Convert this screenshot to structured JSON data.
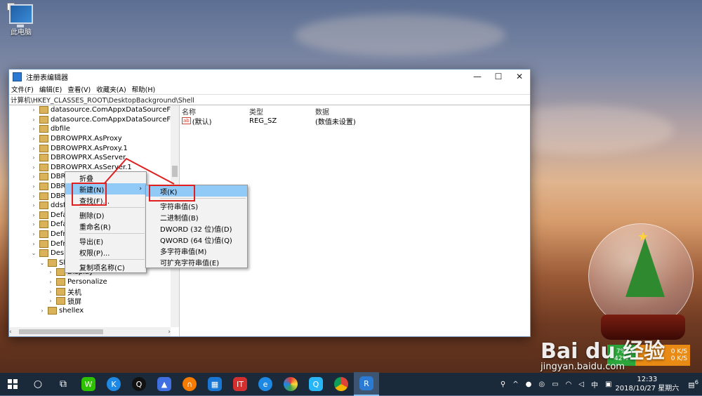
{
  "desktop": {
    "icon_label": "此电脑",
    "checkbox": "✓"
  },
  "window": {
    "title": "注册表编辑器",
    "menu": [
      "文件(F)",
      "编辑(E)",
      "查看(V)",
      "收藏夹(A)",
      "帮助(H)"
    ],
    "address": "计算机\\HKEY_CLASSES_ROOT\\DesktopBackground\\Shell",
    "controls": {
      "minimize": "—",
      "maximize": "☐",
      "close": "✕"
    }
  },
  "tree": [
    {
      "label": "datasource.ComAppxDataSourceFacto",
      "exp": "›"
    },
    {
      "label": "datasource.ComAppxDataSourceFacto",
      "exp": "›"
    },
    {
      "label": "dbfile",
      "exp": "›"
    },
    {
      "label": "DBROWPRX.AsProxy",
      "exp": "›"
    },
    {
      "label": "DBROWPRX.AsProxy.1",
      "exp": "›"
    },
    {
      "label": "DBROWPRX.AsServer",
      "exp": "›"
    },
    {
      "label": "DBROWPRX.AsServer.1",
      "exp": "›"
    },
    {
      "label": "DBRS",
      "exp": "›"
    },
    {
      "label": "DBRS",
      "exp": "›"
    },
    {
      "label": "DBRS",
      "exp": "›"
    },
    {
      "label": "ddsfi",
      "exp": "›"
    },
    {
      "label": "Defau",
      "exp": "›"
    },
    {
      "label": "Defau",
      "exp": "›"
    },
    {
      "label": "Defra",
      "exp": "›"
    },
    {
      "label": "Defra",
      "exp": "›"
    },
    {
      "label": "Desk",
      "exp": "⌄"
    },
    {
      "label": "Sh",
      "exp": "⌄"
    },
    {
      "label": "Display",
      "exp": "›"
    },
    {
      "label": "Personalize",
      "exp": "›"
    },
    {
      "label": "关机",
      "exp": "›"
    },
    {
      "label": "锁屏",
      "exp": "›"
    },
    {
      "label": "shellex",
      "exp": "›"
    }
  ],
  "list": {
    "headers": [
      "名称",
      "类型",
      "数据"
    ],
    "rows": [
      {
        "name": "(默认)",
        "type": "REG_SZ",
        "data": "(数值未设置)",
        "icon": "ab"
      }
    ]
  },
  "context_menu": {
    "items": [
      "折叠",
      "新建(N)",
      "查找(F)...",
      "删除(D)",
      "重命名(R)",
      "导出(E)",
      "权限(P)...",
      "复制项名称(C)"
    ]
  },
  "submenu": {
    "items": [
      "项(K)",
      "字符串值(S)",
      "二进制值(B)",
      "DWORD (32 位)值(D)",
      "QWORD (64 位)值(Q)",
      "多字符串值(M)",
      "可扩充字符串值(E)"
    ]
  },
  "watermark": {
    "brand": "Bai du 经验",
    "url": "jingyan.baidu.com"
  },
  "netmon": {
    "pct1": "7%",
    "pct2": "42%",
    "up": "0 K/S",
    "down": "0 K/S"
  },
  "tray": {
    "ime": "中",
    "time": "12:33",
    "date": "2018/10/27 星期六",
    "notif": "6"
  }
}
